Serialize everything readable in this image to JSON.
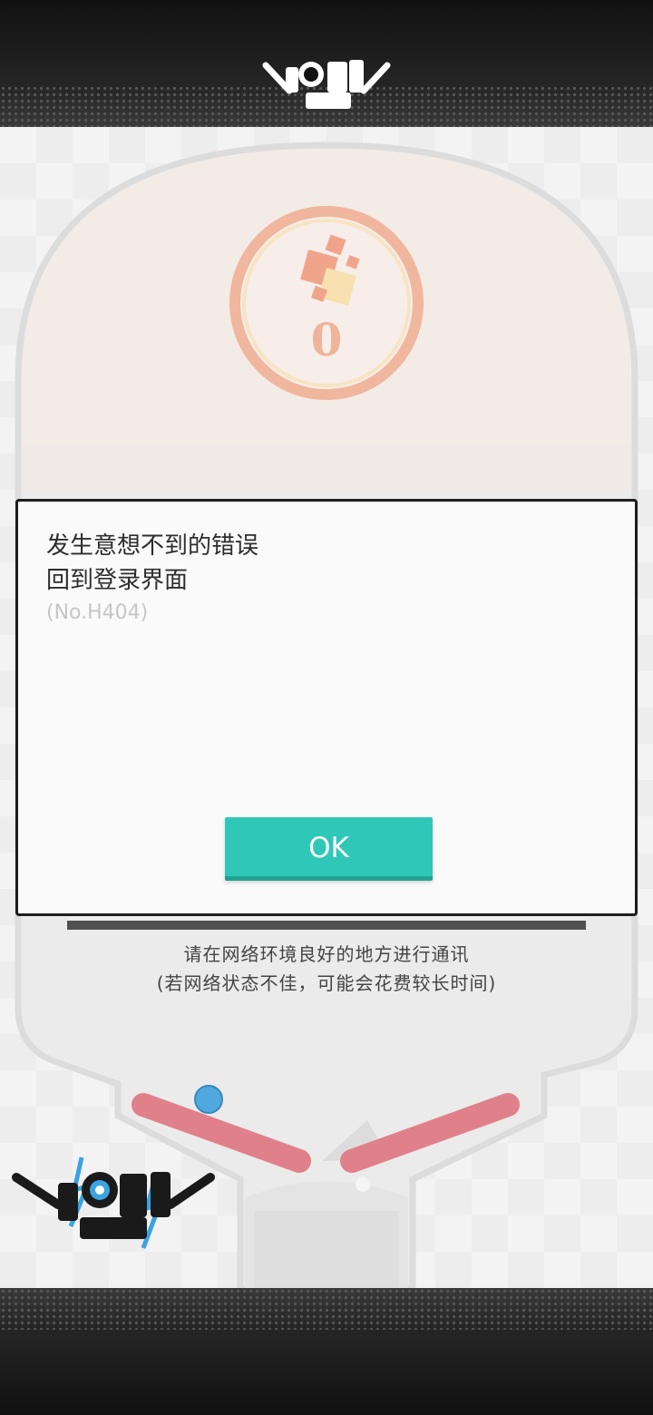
{
  "header": {
    "logo_icon": "pinball-story-logo"
  },
  "score": {
    "value": "0",
    "icon": "score-blocks-icon"
  },
  "dialog": {
    "message_line1": "发生意想不到的错误",
    "message_line2": "回到登录界面",
    "error_code": "(No.H404)",
    "ok_label": "OK",
    "ok_color": "#2fc7b8"
  },
  "network_note": {
    "line1": "请在网络环境良好的地方进行通讯",
    "line2": "(若网络状态不佳，可能会花费较长时间)"
  },
  "colors": {
    "flipper": "#e0808a",
    "ball": "#4fa9df",
    "ring": "#f0b69e"
  }
}
